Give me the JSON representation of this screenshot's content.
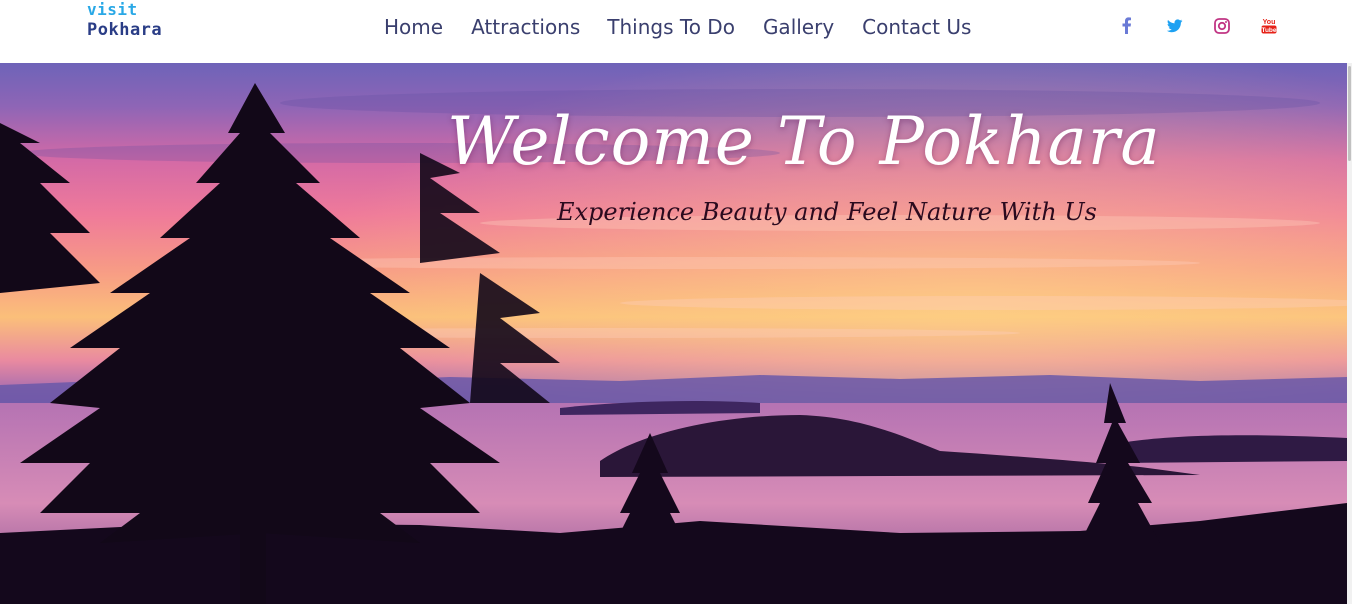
{
  "brand": {
    "line1": "visit",
    "line2": "Pokhara"
  },
  "nav": {
    "items": [
      "Home",
      "Attractions",
      "Things To Do",
      "Gallery",
      "Contact Us"
    ]
  },
  "social": {
    "facebook": {
      "icon": "facebook-icon",
      "color": "#6a7ad6"
    },
    "twitter": {
      "icon": "twitter-icon",
      "color": "#1da1f2"
    },
    "instagram": {
      "icon": "instagram-icon",
      "color": "#c13584"
    },
    "youtube": {
      "icon": "youtube-icon",
      "color": "#e62117",
      "text1": "You",
      "text2": "Tube"
    }
  },
  "hero": {
    "title": "Welcome To Pokhara",
    "subtitle": "Experience Beauty and Feel Nature With Us"
  },
  "colors": {
    "brand_light": "#29a8e6",
    "brand_dark": "#2a3d86",
    "nav_text": "#3a3f6e"
  }
}
